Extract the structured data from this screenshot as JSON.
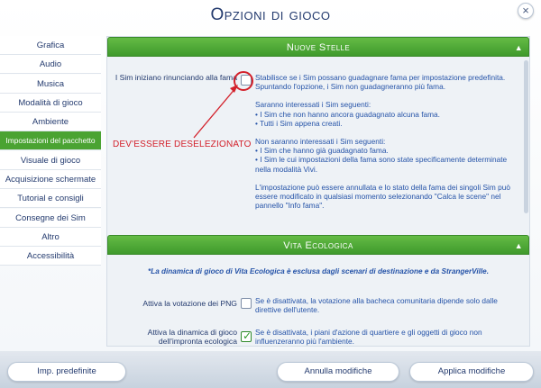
{
  "window": {
    "title": "Opzioni di gioco",
    "close_glyph": "×"
  },
  "sidebar": {
    "items": [
      {
        "label": "Grafica"
      },
      {
        "label": "Audio"
      },
      {
        "label": "Musica"
      },
      {
        "label": "Modalità di gioco"
      },
      {
        "label": "Ambiente"
      },
      {
        "label": "Impostazioni del pacchetto"
      },
      {
        "label": "Visuale di gioco"
      },
      {
        "label": "Acquisizione schermate"
      },
      {
        "label": "Tutorial e consigli"
      },
      {
        "label": "Consegne dei Sim"
      },
      {
        "label": "Altro"
      },
      {
        "label": "Accessibilità"
      }
    ],
    "active_index": 5
  },
  "sections": {
    "nuove_stelle": {
      "header": "Nuove Stelle",
      "option_label": "I Sim iniziano rinunciando alla fama",
      "checked": false,
      "desc_1": "Stabilisce se i Sim possano guadagnare fama per impostazione predefinita. Spuntando l'opzione, i Sim non guadagneranno più fama.",
      "desc_2_title": "Saranno interessati i Sim seguenti:",
      "desc_2_a": "• I Sim che non hanno ancora guadagnato alcuna fama.",
      "desc_2_b": "• Tutti i Sim appena creati.",
      "desc_3_title": "Non saranno interessati i Sim seguenti:",
      "desc_3_a": "• I Sim che hanno già guadagnato fama.",
      "desc_3_b": "• I Sim le cui impostazioni della fama sono state specificamente determinate nella modalità Vivi.",
      "desc_4": "L'impostazione può essere annullata e lo stato della fama dei singoli Sim può essere modificato in qualsiasi momento selezionando \"Calca le scene\" nel pannello \"Info fama\"."
    },
    "vita_ecologica": {
      "header": "Vita Ecologica",
      "notice": "*La dinamica di gioco di Vita Ecologica è esclusa dagli scenari di destinazione e da StrangerVille.",
      "option_1_label": "Attiva la votazione dei PNG",
      "option_1_checked": false,
      "option_1_desc": "Se è disattivata, la votazione alla bacheca comunitaria dipende solo dalle direttive dell'utente.",
      "option_2_label": "Attiva la dinamica di gioco dell'impronta ecologica",
      "option_2_checked": true,
      "option_2_desc": "Se è disattivata, i piani d'azione di quartiere e gli oggetti di gioco non influenzeranno più l'ambiente."
    }
  },
  "annotation": {
    "text": "DEV'ESSERE DESELEZIONATO",
    "color": "#d3202a"
  },
  "footer": {
    "defaults_button": "Imp. predefinite",
    "cancel_button": "Annulla modifiche",
    "apply_button": "Applica modifiche"
  },
  "colors": {
    "accent_green": "#4aa332",
    "text_blue": "#2553a8",
    "title_navy": "#233a6e"
  }
}
